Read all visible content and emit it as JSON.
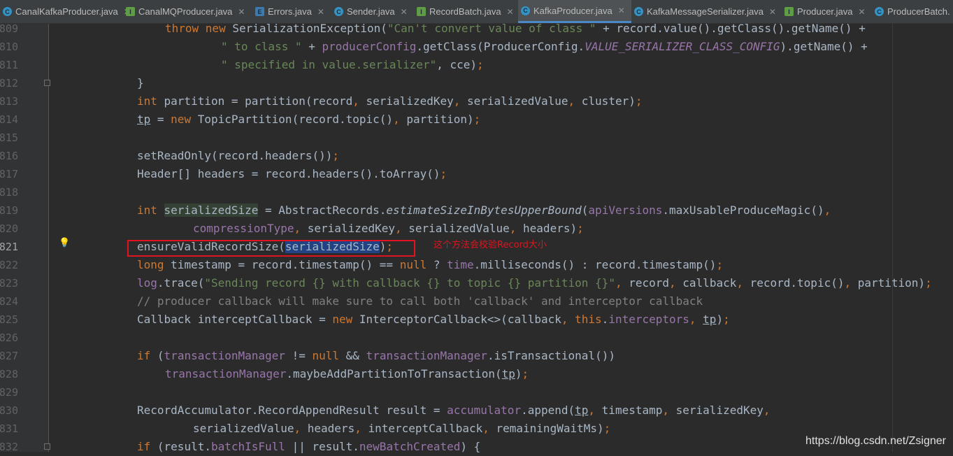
{
  "tabs": [
    {
      "label": "CanalKafkaProducer.java",
      "icon": "class-icon",
      "active": false
    },
    {
      "label": "CanalMQProducer.java",
      "icon": "interface-icon",
      "active": false
    },
    {
      "label": "Errors.java",
      "icon": "enum-icon",
      "active": false
    },
    {
      "label": "Sender.java",
      "icon": "class-icon",
      "active": false
    },
    {
      "label": "RecordBatch.java",
      "icon": "interface-icon",
      "active": false
    },
    {
      "label": "KafkaProducer.java",
      "icon": "class-icon",
      "active": true
    },
    {
      "label": "KafkaMessageSerializer.java",
      "icon": "class-icon",
      "active": false
    },
    {
      "label": "Producer.java",
      "icon": "interface-icon",
      "active": false
    },
    {
      "label": "ProducerBatch.",
      "icon": "class-icon",
      "active": false
    }
  ],
  "line_numbers": [
    "809",
    "810",
    "811",
    "812",
    "813",
    "814",
    "815",
    "816",
    "817",
    "818",
    "819",
    "820",
    "821",
    "822",
    "823",
    "824",
    "825",
    "826",
    "827",
    "828",
    "829",
    "830",
    "831",
    "832"
  ],
  "current_line": "821",
  "annotation_text": "这个方法会校验Record大小",
  "watermark": "https://blog.csdn.net/Zsigner",
  "colors": {
    "background": "#2b2b2b",
    "keyword": "#cc7832",
    "string": "#6a8759",
    "field": "#9876aa",
    "annotation": "#e0141e",
    "selection": "#214283"
  }
}
